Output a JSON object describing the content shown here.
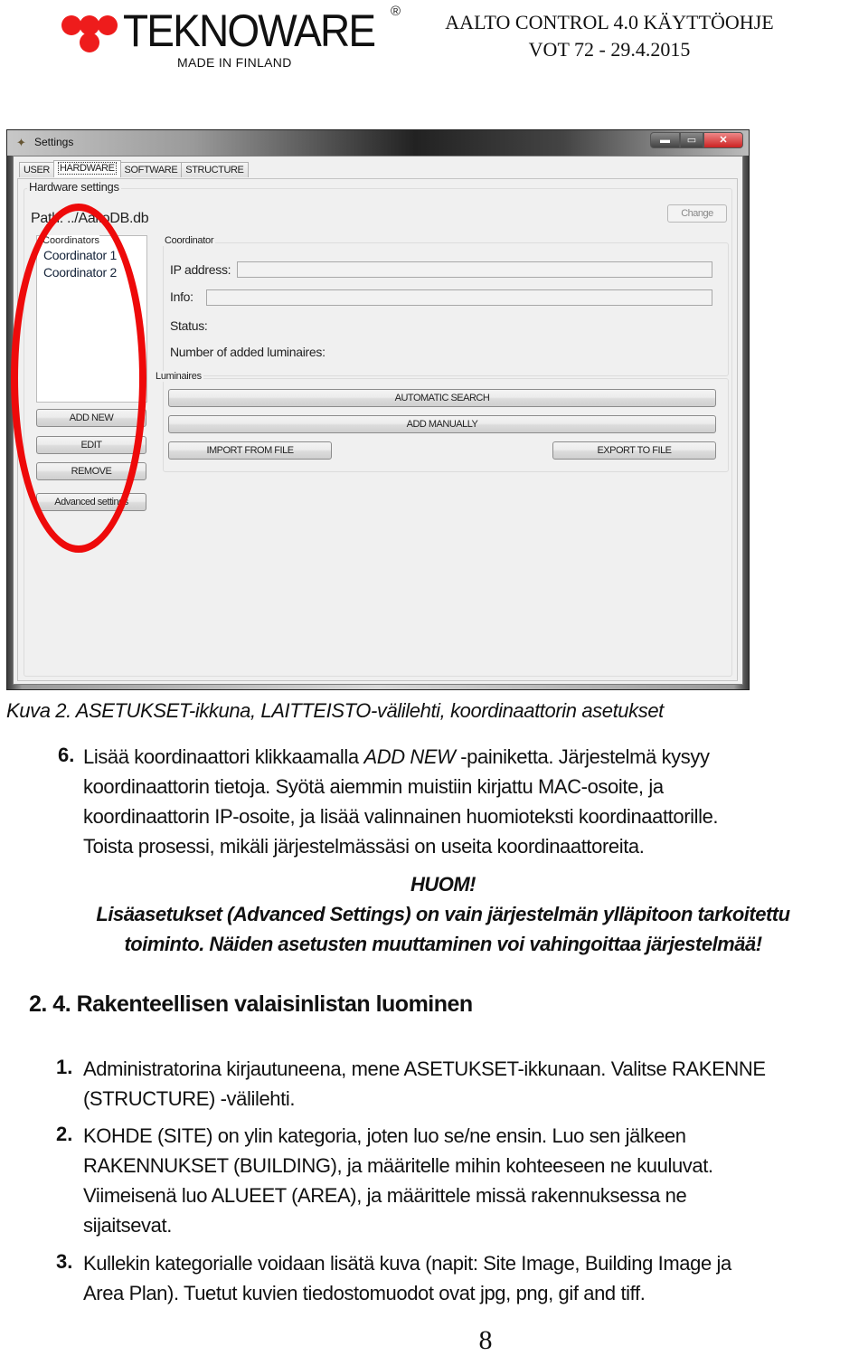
{
  "header": {
    "logo": {
      "brand": "TEKNOWARE",
      "registered": "®",
      "tagline": "MADE IN FINLAND",
      "accent_color": "#ee1c1c"
    },
    "doc_title_line1": "AALTO CONTROL 4.0 KÄYTTÖOHJE",
    "doc_title_line2": "VOT 72 - 29.4.2015"
  },
  "window": {
    "title": "Settings",
    "controls": {
      "minimize": "▬",
      "maximize": "▭",
      "close": "✕"
    },
    "tabs": [
      {
        "label": "USER",
        "active": false
      },
      {
        "label": "HARDWARE",
        "active": true
      },
      {
        "label": "SOFTWARE",
        "active": false
      },
      {
        "label": "STRUCTURE",
        "active": false
      }
    ],
    "hardware_settings": {
      "group_title": "Hardware settings",
      "path_label": "Path:  ../AaltoDB.db",
      "change_button": "Change",
      "coordinators": {
        "group_title": "Coordinators",
        "items": [
          "Coordinator 1",
          "Coordinator 2"
        ],
        "buttons": {
          "add_new": "ADD NEW",
          "edit": "EDIT",
          "remove": "REMOVE",
          "advanced": "Advanced settings"
        }
      },
      "coordinator": {
        "group_title": "Coordinator",
        "ip_label": "IP address:",
        "ip_value": "",
        "info_label": "Info:",
        "info_value": "",
        "status_label": "Status:",
        "luminaires_count_label": "Number of added luminaires:"
      },
      "luminaires": {
        "group_title": "Luminaires",
        "buttons": {
          "automatic_search": "AUTOMATIC SEARCH",
          "add_manually": "ADD MANUALLY",
          "import_from_file": "IMPORT FROM FILE",
          "export_to_file": "EXPORT TO FILE"
        }
      }
    },
    "annotation_color": "#ee0a0a"
  },
  "body": {
    "caption": "Kuva 2. ASETUKSET-ikkuna, LAITTEISTO-välilehti, koordinaattorin asetukset",
    "step6": {
      "number": "6.",
      "lines": [
        "Lisää koordinaattori klikkaamalla ADD NEW -painiketta. Järjestelmä kysyy",
        "koordinaattorin tietoja. Syötä aiemmin muistiin kirjattu MAC-osoite, ja",
        "koordinaattorin IP-osoite, ja lisää valinnainen huomioteksti koordinaattorille.",
        "Toista prosessi, mikäli järjestelmässäsi on useita koordinaattoreita."
      ],
      "line1_pre": "Lisää koordinaattori klikkaamalla ",
      "line1_em": "ADD NEW",
      "line1_post": " -painiketta. Järjestelmä kysyy"
    },
    "warning": {
      "title": "HUOM!",
      "line1": "Lisäasetukset (Advanced Settings) on vain järjestelmän ylläpitoon tarkoitettu",
      "line2": "toiminto. Näiden asetusten muuttaminen voi vahingoittaa järjestelmää!"
    },
    "section_title": "2. 4. Rakenteellisen valaisinlistan luominen",
    "steps": [
      {
        "number": "1.",
        "lines": [
          "Administratorina kirjautuneena, mene ASETUKSET-ikkunaan. Valitse RAKENNE",
          "(STRUCTURE) -välilehti."
        ]
      },
      {
        "number": "2.",
        "lines": [
          "KOHDE (SITE) on ylin kategoria, joten luo se/ne ensin. Luo sen jälkeen",
          "RAKENNUKSET (BUILDING), ja määritelle mihin kohteeseen ne kuuluvat.",
          "Viimeisenä luo ALUEET (AREA), ja määrittele missä rakennuksessa ne",
          "sijaitsevat."
        ]
      },
      {
        "number": "3.",
        "lines": [
          "Kullekin kategorialle voidaan lisätä kuva (napit: Site Image, Building Image ja",
          "Area Plan). Tuetut kuvien tiedostomuodot ovat jpg, png, gif and tiff."
        ]
      }
    ],
    "page_number": "8"
  }
}
